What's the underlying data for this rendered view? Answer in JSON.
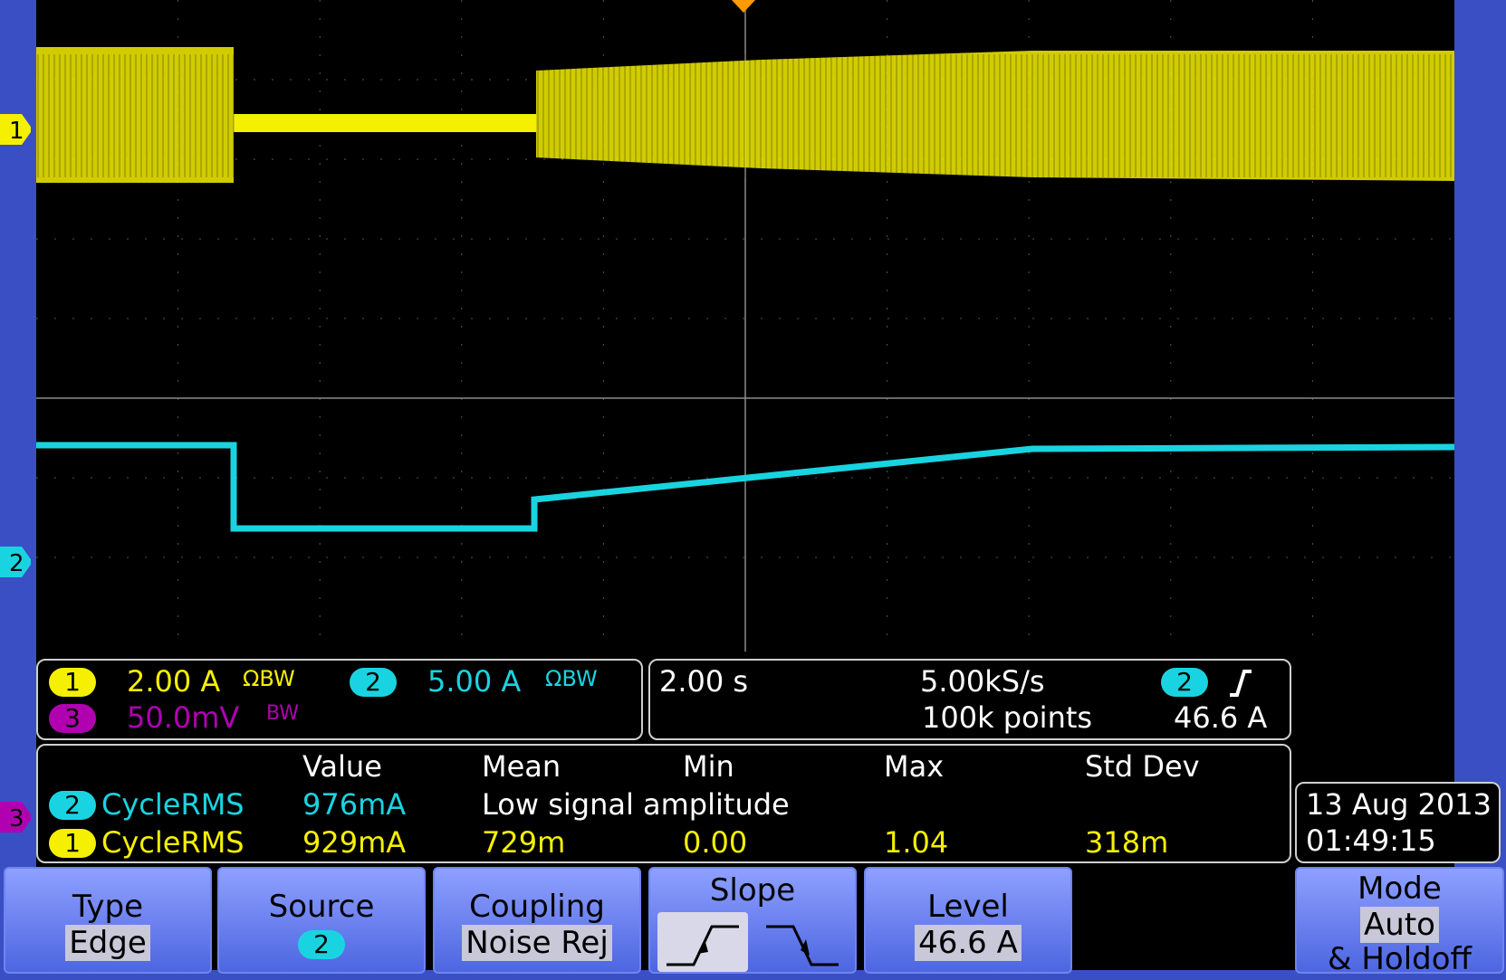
{
  "channels": {
    "ch1": {
      "id": "1",
      "scale": "2.00 A",
      "color": "#f5f000"
    },
    "ch2": {
      "id": "2",
      "scale": "5.00 A",
      "color": "#19d4e0"
    },
    "ch3": {
      "id": "3",
      "scale": "50.0mV",
      "color": "#b000b0"
    }
  },
  "bw_icon": "ΩBW",
  "bw_icon_small": "BW",
  "timebase": {
    "horizontal": "2.00 s",
    "sample_rate": "5.00kS/s",
    "record_length": "100k points",
    "trigger_source": "2",
    "trigger_level": "46.6 A"
  },
  "measurements": {
    "headers": [
      "Value",
      "Mean",
      "Min",
      "Max",
      "Std Dev"
    ],
    "rows": [
      {
        "ch": "2",
        "name": "CycleRMS",
        "value": "976mA",
        "note": "Low signal amplitude"
      },
      {
        "ch": "1",
        "name": "CycleRMS",
        "value": "929mA",
        "mean": "729m",
        "min": "0.00",
        "max": "1.04",
        "std": "318m"
      }
    ]
  },
  "datetime": {
    "date": "13 Aug 2013",
    "time": "01:49:15"
  },
  "menu": {
    "type": {
      "label": "Type",
      "value": "Edge"
    },
    "source": {
      "label": "Source",
      "value": "2"
    },
    "coupling": {
      "label": "Coupling",
      "value": "Noise Rej"
    },
    "slope": {
      "label": "Slope"
    },
    "level": {
      "label": "Level",
      "value": "46.6 A"
    },
    "mode": {
      "label": "Mode",
      "value": "Auto",
      "extra": "& Holdoff"
    }
  }
}
